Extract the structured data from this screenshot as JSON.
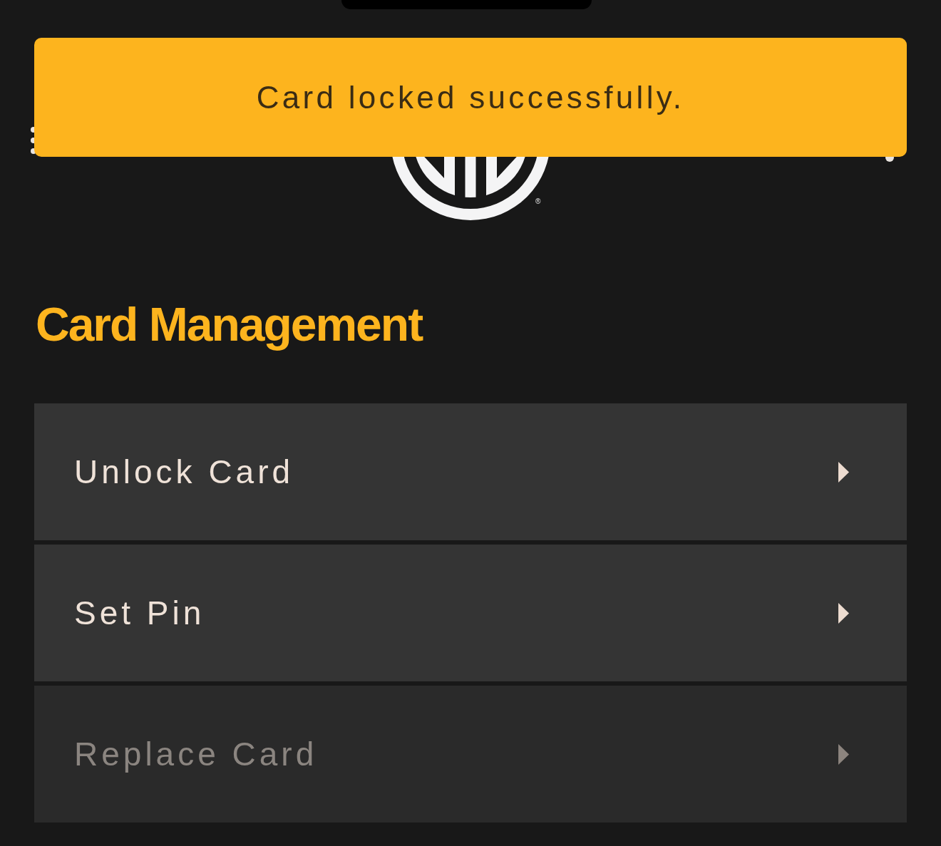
{
  "toast": {
    "message": "Card locked successfully."
  },
  "header": {
    "logo_mark": "®"
  },
  "section_title": "Card Management",
  "menu_items": [
    {
      "label": "Unlock Card",
      "disabled": false
    },
    {
      "label": "Set Pin",
      "disabled": false
    },
    {
      "label": "Replace Card",
      "disabled": true
    }
  ]
}
